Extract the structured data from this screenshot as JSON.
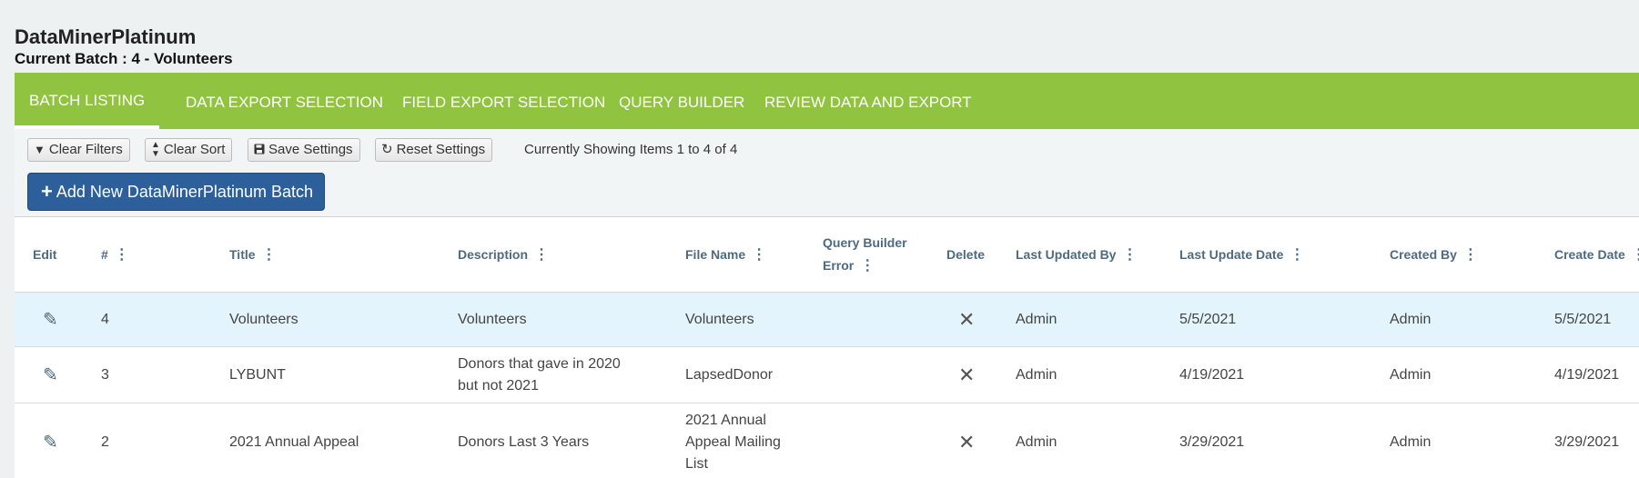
{
  "app": {
    "title": "DataMinerPlatinum",
    "current_batch": "Current Batch : 4 - Volunteers"
  },
  "nav": {
    "items": [
      {
        "label": "BATCH LISTING",
        "active": true
      },
      {
        "label": "DATA EXPORT SELECTION",
        "active": false
      },
      {
        "label": "FIELD EXPORT SELECTION",
        "active": false
      },
      {
        "label": "QUERY BUILDER",
        "active": false
      },
      {
        "label": "REVIEW DATA AND EXPORT",
        "active": false
      }
    ]
  },
  "toolbar": {
    "clear_filters": "Clear Filters",
    "clear_sort": "Clear Sort",
    "save_settings": "Save Settings",
    "reset_settings": "Reset Settings",
    "showing": "Currently Showing Items 1 to 4 of 4",
    "add_batch": "Add New DataMinerPlatinum Batch"
  },
  "table": {
    "columns": {
      "edit": "Edit",
      "num": "#",
      "title": "Title",
      "description": "Description",
      "file_name": "File Name",
      "qb_error_1": "Query Builder",
      "qb_error_2": "Error",
      "delete": "Delete",
      "last_updated_by": "Last Updated By",
      "last_update_date": "Last Update Date",
      "created_by": "Created By",
      "create_date": "Create Date"
    },
    "rows": [
      {
        "num": "4",
        "title": "Volunteers",
        "description": "Volunteers",
        "file_name": "Volunteers",
        "qb_error": "",
        "last_updated_by": "Admin",
        "last_update_date": "5/5/2021",
        "created_by": "Admin",
        "create_date": "5/5/2021"
      },
      {
        "num": "3",
        "title": "LYBUNT",
        "description": "Donors that gave in 2020 but not 2021",
        "file_name": "LapsedDonor",
        "qb_error": "",
        "last_updated_by": "Admin",
        "last_update_date": "4/19/2021",
        "created_by": "Admin",
        "create_date": "4/19/2021"
      },
      {
        "num": "2",
        "title": "2021 Annual Appeal",
        "description": "Donors Last 3 Years",
        "file_name": "2021 Annual Appeal Mailing List",
        "qb_error": "",
        "last_updated_by": "Admin",
        "last_update_date": "3/29/2021",
        "created_by": "Admin",
        "create_date": "3/29/2021"
      }
    ]
  },
  "icons": {
    "edit": "pencil-icon",
    "delete": "close-icon",
    "column_menu": "kebab-icon"
  },
  "colors": {
    "nav_bg": "#8fc340",
    "primary_button": "#2d5f9a",
    "selected_row": "#e3f4fc",
    "header_text": "#4d6a80"
  }
}
